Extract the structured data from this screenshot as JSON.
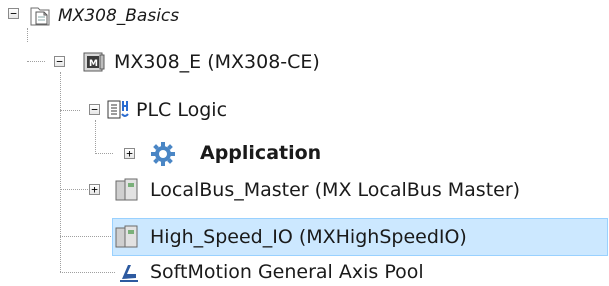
{
  "tree": {
    "nodes": [
      {
        "label": "MX308_Basics",
        "expander": "⊟",
        "icon": "project-icon"
      },
      {
        "label": "MX308_E (MX308-CE)",
        "expander": "⊟",
        "icon": "controller-device-icon"
      },
      {
        "label": "PLC Logic",
        "expander": "⊟",
        "icon": "plc-logic-icon"
      },
      {
        "label": "Application",
        "expander": "⊞",
        "icon": "application-gear-icon"
      },
      {
        "label": "LocalBus_Master (MX LocalBus Master)",
        "expander": "⊞",
        "icon": "module-icon"
      },
      {
        "label": "High_Speed_IO (MXHighSpeedIO)",
        "icon": "module-icon",
        "selected": true
      },
      {
        "label": "SoftMotion General Axis Pool",
        "icon": "axis-pool-icon"
      }
    ]
  },
  "colors": {
    "selection_bg": "#cce8ff",
    "selection_border": "#99d1ff",
    "connector": "#a0a0a0",
    "gear": "#4a86c5"
  }
}
